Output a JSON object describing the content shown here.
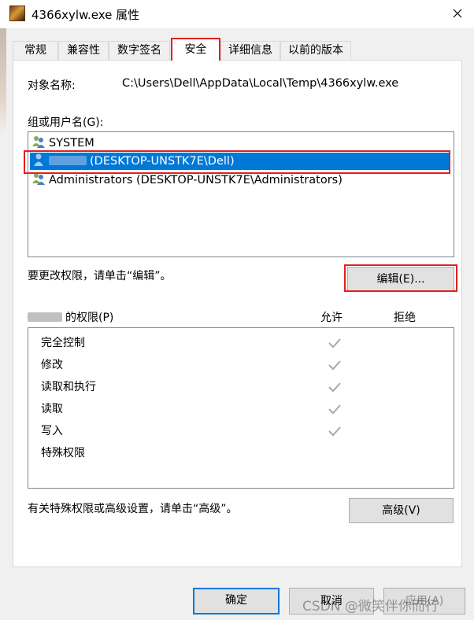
{
  "window": {
    "title": "4366xylw.exe 属性",
    "close_glyph": "✕"
  },
  "tabs": [
    {
      "label": "常规",
      "active": false
    },
    {
      "label": "兼容性",
      "active": false
    },
    {
      "label": "数字签名",
      "active": false
    },
    {
      "label": "安全",
      "active": true
    },
    {
      "label": "详细信息",
      "active": false
    },
    {
      "label": "以前的版本",
      "active": false
    }
  ],
  "security": {
    "object_name_label": "对象名称:",
    "object_name_value": "C:\\Users\\Dell\\AppData\\Local\\Temp\\4366xylw.exe",
    "groups_label": "组或用户名(G):",
    "groups": [
      {
        "name": "SYSTEM",
        "icon": "group-users-icon",
        "selected": false
      },
      {
        "name": "(DESKTOP-UNSTK7E\\Dell)",
        "icon": "user-icon",
        "selected": true
      },
      {
        "name": "Administrators (DESKTOP-UNSTK7E\\Administrators)",
        "icon": "group-users-icon",
        "selected": false
      }
    ],
    "change_hint": "要更改权限，请单击“编辑”。",
    "edit_button": "编辑(E)...",
    "permissions_for": "的权限(P)",
    "allow_header": "允许",
    "deny_header": "拒绝",
    "permissions": [
      {
        "name": "完全控制",
        "allow": true,
        "deny": false
      },
      {
        "name": "修改",
        "allow": true,
        "deny": false
      },
      {
        "name": "读取和执行",
        "allow": true,
        "deny": false
      },
      {
        "name": "读取",
        "allow": true,
        "deny": false
      },
      {
        "name": "写入",
        "allow": true,
        "deny": false
      },
      {
        "name": "特殊权限",
        "allow": false,
        "deny": false
      }
    ],
    "advanced_hint": "有关特殊权限或高级设置，请单击“高级”。",
    "advanced_button": "高级(V)"
  },
  "footer": {
    "ok": "确定",
    "cancel": "取消",
    "apply": "应用(A)"
  },
  "watermark": "CSDN @微笑伴你而行",
  "colors": {
    "selection": "#0078d7",
    "highlight_outline": "#e02020",
    "check": "#a8a8a8"
  }
}
